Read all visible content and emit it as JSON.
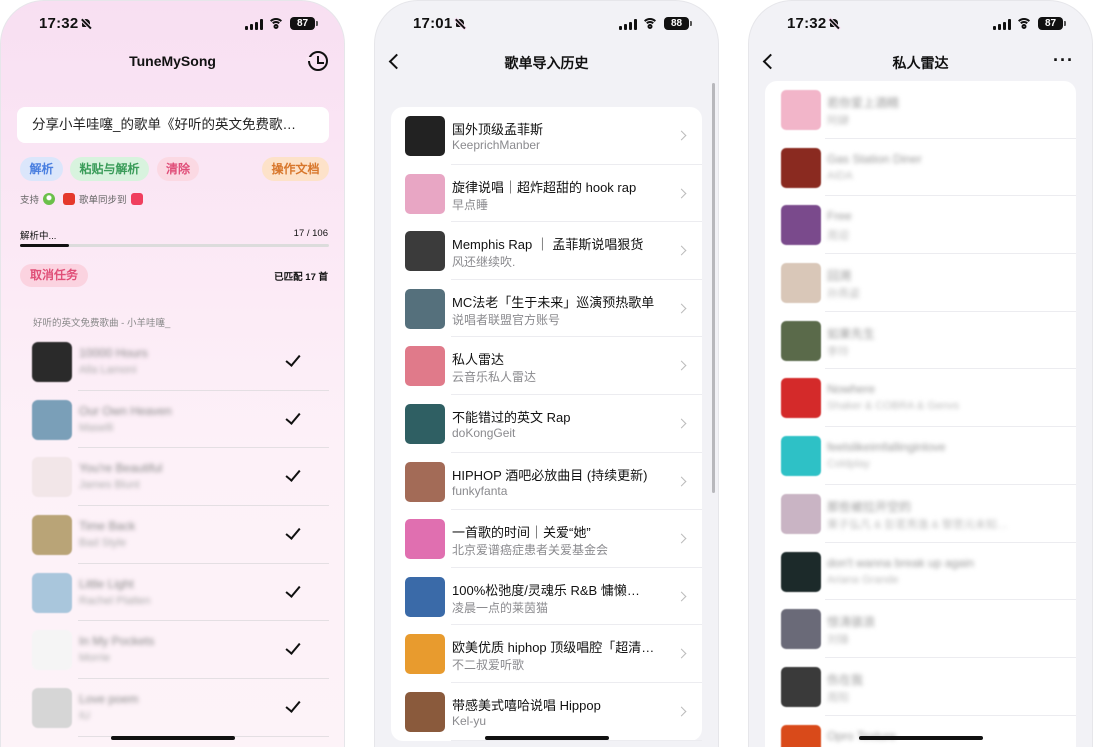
{
  "phone1": {
    "status": {
      "time": "17:32",
      "battery": "87"
    },
    "title": "TuneMySong",
    "share_text": "分享小羊哇噻_的歌单《好听的英文免费歌…",
    "buttons": {
      "parse": "解析",
      "paste_parse": "粘贴与解析",
      "clear": "清除",
      "docs": "操作文档"
    },
    "support_label": "支持",
    "sync_label": "歌单同步到",
    "progress": {
      "label": "解析中...",
      "count": "17 / 106",
      "fraction": 0.16
    },
    "cancel": "取消任务",
    "matched": "已匹配 17 首",
    "playlist_label": "好听的英文免费歌曲 - 小羊哇噻_",
    "songs": [
      {
        "title": "10000 Hours",
        "artist": "Alla Lamoni",
        "color": "#2a2a2a"
      },
      {
        "title": "Our Own Heaven",
        "artist": "Maselli",
        "color": "#7a9fb8"
      },
      {
        "title": "You're Beautiful",
        "artist": "James Blunt",
        "color": "#f2e6e8"
      },
      {
        "title": "Time Back",
        "artist": "Bad Style",
        "color": "#b9a477"
      },
      {
        "title": "Little Light",
        "artist": "Rachel Platten",
        "color": "#a9c6dc"
      },
      {
        "title": "In My Pockets",
        "artist": "Morrie",
        "color": "#f5f5f5"
      },
      {
        "title": "Love poem",
        "artist": "IU",
        "color": "#d6d6d6"
      }
    ]
  },
  "phone2": {
    "status": {
      "time": "17:01",
      "battery": "88"
    },
    "title": "歌单导入历史",
    "items": [
      {
        "title": "国外顶级孟菲斯",
        "sub": "KeeprichManber",
        "color": "#222222"
      },
      {
        "title": "旋律说唱｜超炸超甜的 hook rap",
        "sub": "早点睡",
        "color": "#e8a6c4"
      },
      {
        "title": "Memphis Rap ｜ 孟菲斯说唱狠货",
        "sub": "风还继续吹.",
        "color": "#3b3b3b"
      },
      {
        "title": "MC法老「生于未来」巡演预热歌单",
        "sub": "说唱者联盟官方账号",
        "color": "#55707c"
      },
      {
        "title": "私人雷达",
        "sub": "云音乐私人雷达",
        "color": "#e07a8a"
      },
      {
        "title": "不能错过的英文 Rap",
        "sub": "doKongGeit",
        "color": "#2f5f63"
      },
      {
        "title": "HIPHOP 酒吧必放曲目 (持续更新)",
        "sub": "funkyfanta",
        "color": "#a36b57"
      },
      {
        "title": "一首歌的时间｜关爱“她”",
        "sub": "北京爱谱癌症患者关爱基金会",
        "color": "#e06fb0"
      },
      {
        "title": "100%松弛度/灵魂乐 R&B 慵懒…",
        "sub": "凌晨一点的莱茵猫",
        "color": "#3a6aa8"
      },
      {
        "title": "欧美优质 hiphop 顶级唱腔「超清…",
        "sub": "不二叔爱听歌",
        "color": "#e89b2e"
      },
      {
        "title": "带感美式嘻哈说唱 Hippop",
        "sub": "Kel-yu",
        "color": "#8a5a3c"
      }
    ]
  },
  "phone3": {
    "status": {
      "time": "17:32",
      "battery": "87"
    },
    "title": "私人雷达",
    "items": [
      {
        "title": "若你爱上酒精",
        "sub": "阿肆",
        "color": "#f2b5c9"
      },
      {
        "title": "Gas Station Diner",
        "sub": "AIDA",
        "color": "#8a2a20"
      },
      {
        "title": "Free",
        "sub": "周迎",
        "color": "#7a4a8c"
      },
      {
        "title": "回溯",
        "sub": "孙燕姿",
        "color": "#d9c7b8"
      },
      {
        "title": "如果先生",
        "sub": "李玲",
        "color": "#5a6a4a"
      },
      {
        "title": "Nowhere",
        "sub": "Shaker & COBRA & Genvs",
        "color": "#d42a2a"
      },
      {
        "title": "feelslikeimfallinginlove",
        "sub": "Coldplay",
        "color": "#2ec1c6"
      },
      {
        "title": "那些被拉开空的",
        "sub": "果子弘凡 & 彭茗秀逸 & 黎思元未知…",
        "color": "#c9b4c4"
      },
      {
        "title": "don't wanna break up again",
        "sub": "Ariana Grande",
        "color": "#1c2a2a"
      },
      {
        "title": "惊涛骇浪",
        "sub": "刘锋",
        "color": "#6a6a78"
      },
      {
        "title": "伤在我",
        "sub": "周阳",
        "color": "#3a3a3a"
      },
      {
        "title": "Opro Texture",
        "sub": "",
        "color": "#d94a1a"
      }
    ]
  }
}
